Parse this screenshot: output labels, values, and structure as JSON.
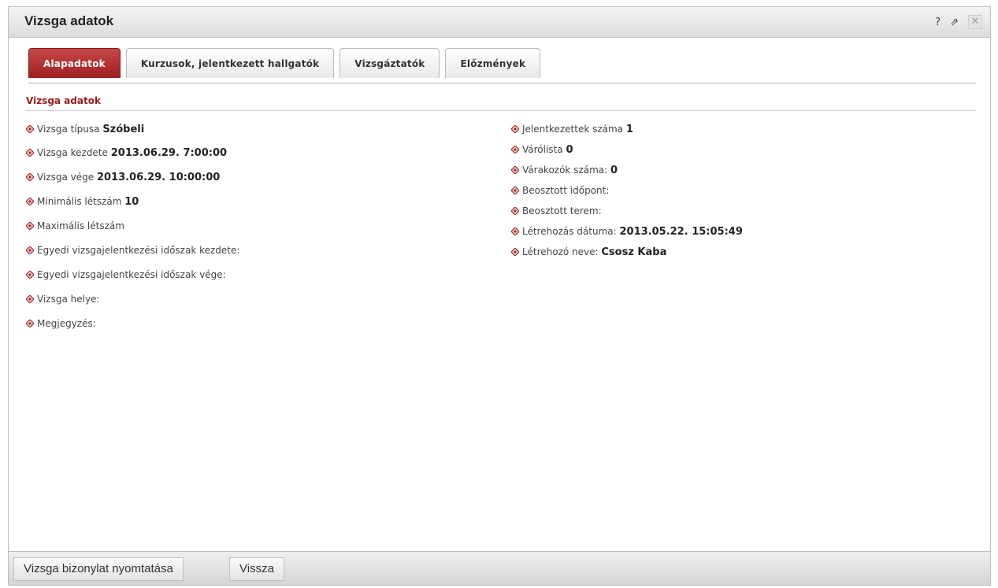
{
  "dialog": {
    "title": "Vizsga adatok",
    "icons": {
      "help": "?",
      "popout": "⇗",
      "close": "✕"
    }
  },
  "tabs": [
    {
      "label": "Alapadatok",
      "active": true
    },
    {
      "label": "Kurzusok, jelentkezett hallgatók",
      "active": false
    },
    {
      "label": "Vizsgáztatók",
      "active": false
    },
    {
      "label": "Előzmények",
      "active": false
    }
  ],
  "section": {
    "title": "Vizsga adatok"
  },
  "left_fields": [
    {
      "label": "Vizsga típusa",
      "value": "Szóbeli"
    },
    {
      "label": "Vizsga kezdete",
      "value": "2013.06.29. 7:00:00"
    },
    {
      "label": "Vizsga vége",
      "value": "2013.06.29. 10:00:00"
    },
    {
      "label": "Minimális létszám",
      "value": "10"
    },
    {
      "label": "Maximális létszám",
      "value": ""
    },
    {
      "label": "Egyedi vizsgajelentkezési időszak kezdete:",
      "value": ""
    },
    {
      "label": "Egyedi vizsgajelentkezési időszak vége:",
      "value": ""
    },
    {
      "label": "Vizsga helye:",
      "value": ""
    },
    {
      "label": "Megjegyzés:",
      "value": ""
    }
  ],
  "right_fields": [
    {
      "label": "Jelentkezettek száma",
      "value": "1"
    },
    {
      "label": "Várólista",
      "value": "0"
    },
    {
      "label": "Várakozók száma:",
      "value": "0"
    },
    {
      "label": "Beosztott időpont:",
      "value": ""
    },
    {
      "label": "Beosztott terem:",
      "value": ""
    },
    {
      "label": "Létrehozás dátuma:",
      "value": "2013.05.22. 15:05:49"
    },
    {
      "label": "Létrehozó neve:",
      "value": "Csosz Kaba"
    }
  ],
  "footer": {
    "print_label": "Vizsga bizonylat nyomtatása",
    "back_label": "Vissza"
  },
  "colors": {
    "accent": "#9b1b1b",
    "bullet": "#9b2a2a"
  }
}
